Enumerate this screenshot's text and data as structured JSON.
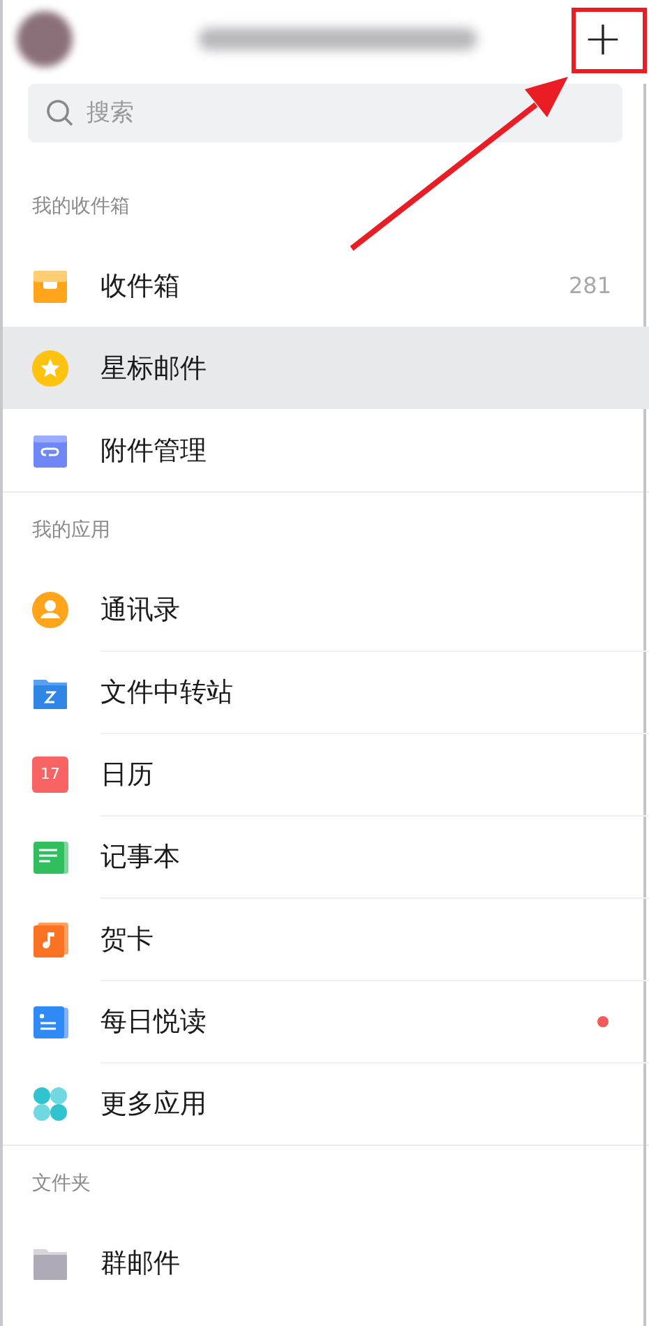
{
  "header": {
    "add_button": "+"
  },
  "search": {
    "placeholder": "搜索"
  },
  "sections": [
    {
      "title": "我的收件箱",
      "items": [
        {
          "kind": "inbox",
          "label": "收件箱",
          "count": "281",
          "selected": false
        },
        {
          "kind": "star",
          "label": "星标邮件",
          "selected": true
        },
        {
          "kind": "attachment",
          "label": "附件管理",
          "selected": false
        }
      ]
    },
    {
      "title": "我的应用",
      "items": [
        {
          "kind": "contacts",
          "label": "通讯录",
          "selected": false
        },
        {
          "kind": "transfer",
          "label": "文件中转站",
          "selected": false
        },
        {
          "kind": "calendar",
          "label": "日历",
          "icon_label": "17",
          "selected": false
        },
        {
          "kind": "notes",
          "label": "记事本",
          "selected": false
        },
        {
          "kind": "card",
          "label": "贺卡",
          "selected": false
        },
        {
          "kind": "reading",
          "label": "每日悦读",
          "dot": true,
          "selected": false
        },
        {
          "kind": "apps",
          "label": "更多应用",
          "selected": false
        }
      ]
    },
    {
      "title": "文件夹",
      "items": [
        {
          "kind": "folder",
          "label": "群邮件",
          "selected": false
        }
      ]
    }
  ]
}
